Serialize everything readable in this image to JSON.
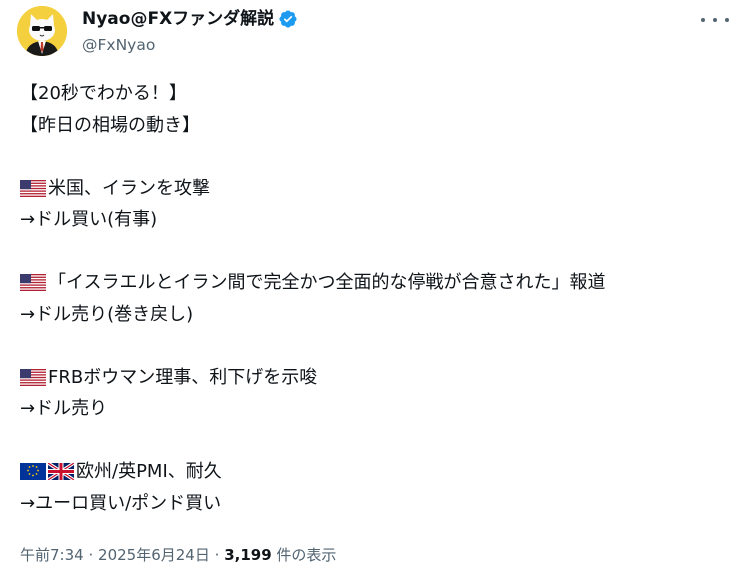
{
  "author": {
    "display_name": "Nyao@FXファンダ解説",
    "handle": "@FxNyao",
    "avatar_icon": "cat-in-suit-avatar",
    "verified_icon": "verified-badge-icon"
  },
  "tweet": {
    "lines": {
      "l1": "【20秒でわかる！】",
      "l2": "【昨日の相場の動き】",
      "l3": "米国、イランを攻撃",
      "l4": "→ドル買い(有事)",
      "l5": "「イスラエルとイラン間で完全かつ全面的な停戦が合意された」報道",
      "l6": "→ドル売り(巻き戻し)",
      "l7": "FRBボウマン理事、利下げを示唆",
      "l8": "→ドル売り",
      "l9": "欧州/英PMI、耐久",
      "l10": "→ユーロ買い/ポンド買い"
    },
    "flags": [
      "us-flag-icon",
      "eu-flag-icon",
      "uk-flag-icon"
    ]
  },
  "meta": {
    "time": "午前7:34",
    "separator": "·",
    "date": "2025年6月24日",
    "views": "3,199",
    "views_label": "件の表示"
  },
  "colors": {
    "text": "#0f1419",
    "secondary": "#536471",
    "verified": "#1d9bf0"
  }
}
